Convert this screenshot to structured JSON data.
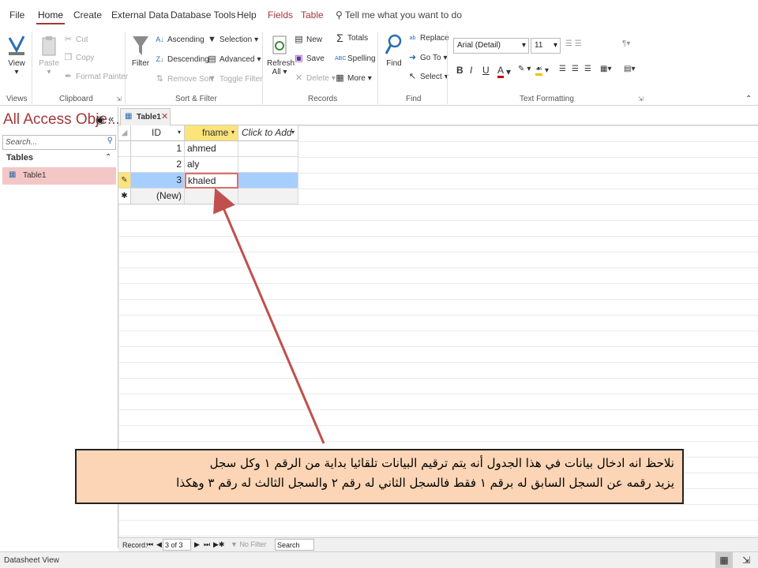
{
  "tabs": [
    "File",
    "Home",
    "Create",
    "External Data",
    "Database Tools",
    "Help"
  ],
  "context_tabs": [
    "Fields",
    "Table"
  ],
  "tell_me": "Tell me what you want to do",
  "ribbon": {
    "views": {
      "view": "View",
      "group": "Views"
    },
    "clipboard": {
      "paste": "Paste",
      "cut": "Cut",
      "copy": "Copy",
      "format_painter": "Format Painter",
      "group": "Clipboard"
    },
    "sort_filter": {
      "filter": "Filter",
      "ascending": "Ascending",
      "descending": "Descending",
      "remove_sort": "Remove Sort",
      "selection": "Selection",
      "advanced": "Advanced",
      "toggle_filter": "Toggle Filter",
      "group": "Sort & Filter"
    },
    "records": {
      "refresh": "Refresh",
      "refresh_all": "All",
      "new": "New",
      "save": "Save",
      "delete": "Delete",
      "totals": "Totals",
      "spelling": "Spelling",
      "more": "More",
      "group": "Records"
    },
    "find": {
      "find": "Find",
      "replace": "Replace",
      "goto": "Go To",
      "select": "Select",
      "group": "Find"
    },
    "text": {
      "font": "Arial (Detail)",
      "size": "11",
      "bold": "B",
      "italic": "I",
      "underline": "U",
      "group": "Text Formatting"
    }
  },
  "nav": {
    "title": "All Access Obje...",
    "search": "Search...",
    "section": "Tables",
    "item": "Table1"
  },
  "doc_tab": "Table1",
  "table": {
    "headers": [
      "ID",
      "fname",
      "Click to Add"
    ],
    "rows": [
      {
        "id": "1",
        "fname": "ahmed"
      },
      {
        "id": "2",
        "fname": "aly"
      },
      {
        "id": "3",
        "fname": "khaled"
      }
    ],
    "new_row": "(New)"
  },
  "record_nav": {
    "label": "Record:",
    "position": "3 of 3",
    "no_filter": "No Filter",
    "search": "Search"
  },
  "status": "Datasheet View",
  "callout": {
    "line1": "نلاحظ انه ادخال بيانات في هذا الجدول أنه يتم ترقيم البيانات تلقائيا بداية من الرقم ١ وكل سجل",
    "line2": "يزيد رقمه عن السجل السابق له برقم ١ فقط فالسجل الثاني له رقم ٢ والسجل الثالث له رقم ٣ وهكذا"
  },
  "colors": {
    "accent": "#a4373a",
    "header_highlight": "#fce47a",
    "selected_row": "#a6cfff",
    "callout_bg": "#fbd5b5",
    "arrow": "#c0504d"
  }
}
